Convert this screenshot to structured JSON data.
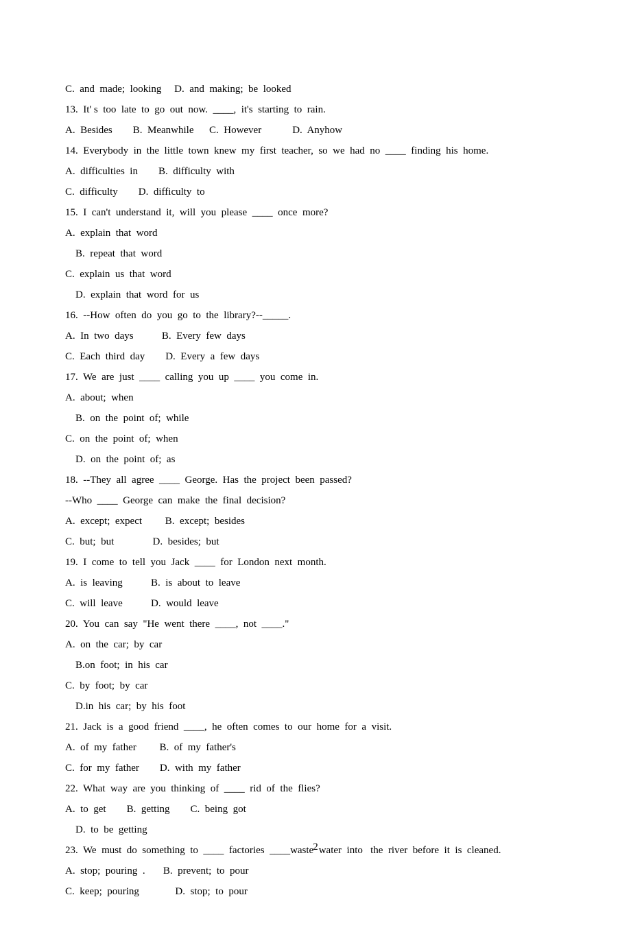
{
  "page_number": "2",
  "lines": [
    "C.  and  made;  looking     D.  and  making;  be  looked",
    "13.  It' s  too  late  to  go  out  now.  ____,  it's  starting  to  rain.",
    "",
    "A.  Besides        B.  Meanwhile      C.  However            D.  Anyhow",
    "14.  Everybody  in  the  little  town  knew  my  first  teacher,  so  we  had  no  ____  finding  his  home.",
    "A.  difficulties  in        B.  difficulty  with",
    "C.  difficulty        D.  difficulty  to",
    "15.  I  can't  understand  it,  will  you  please  ____  once  more?",
    "A.  explain  that  word",
    "    B.  repeat  that  word",
    "C.  explain  us  that  word",
    "    D.  explain  that  word  for  us",
    "16.  --How  often  do  you  go  to  the  library?--_____.",
    "A.  In  two  days           B.  Every  few  days",
    "C.  Each  third  day        D.  Every  a  few  days",
    "17.  We  are  just  ____  calling  you  up  ____  you  come  in.",
    "A.  about;  when",
    "    B.  on  the  point  of;  while",
    "C.  on  the  point  of;  when",
    "    D.  on  the  point  of;  as",
    "18.  --They  all  agree  ____  George.  Has  the  project  been  passed?",
    "--Who  ____  George  can  make  the  final  decision?",
    "A.  except;  expect         B.  except;  besides",
    "C.  but;  but               D.  besides;  but",
    "19.  I  come  to  tell  you  Jack  ____  for  London  next  month.",
    "A.  is  leaving           B.  is  about  to  leave",
    "C.  will  leave           D.  would  leave",
    "20.  You  can  say  \"He  went  there  ____,  not  ____.\"",
    "A.  on  the  car;  by  car",
    "    B.on  foot;  in  his  car",
    "C.  by  foot;  by  car",
    "    D.in  his  car;  by  his  foot",
    "21.  Jack  is  a  good  friend  ____,  he  often  comes  to  our  home  for  a  visit.",
    "A.  of  my  father         B.  of  my  father's",
    "C.  for  my  father        D.  with  my  father",
    "22.  What  way  are  you  thinking  of  ____  rid  of  the  flies?",
    "A.  to  get        B.  getting        C.  being  got",
    "    D.  to  be  getting",
    "23.  We  must  do  something  to  ____  factories  ____waste  water  into   the  river  before  it  is  cleaned.",
    "A.  stop;  pouring  .       B.  prevent;  to  pour",
    "C.  keep;  pouring              D.  stop;  to  pour"
  ]
}
